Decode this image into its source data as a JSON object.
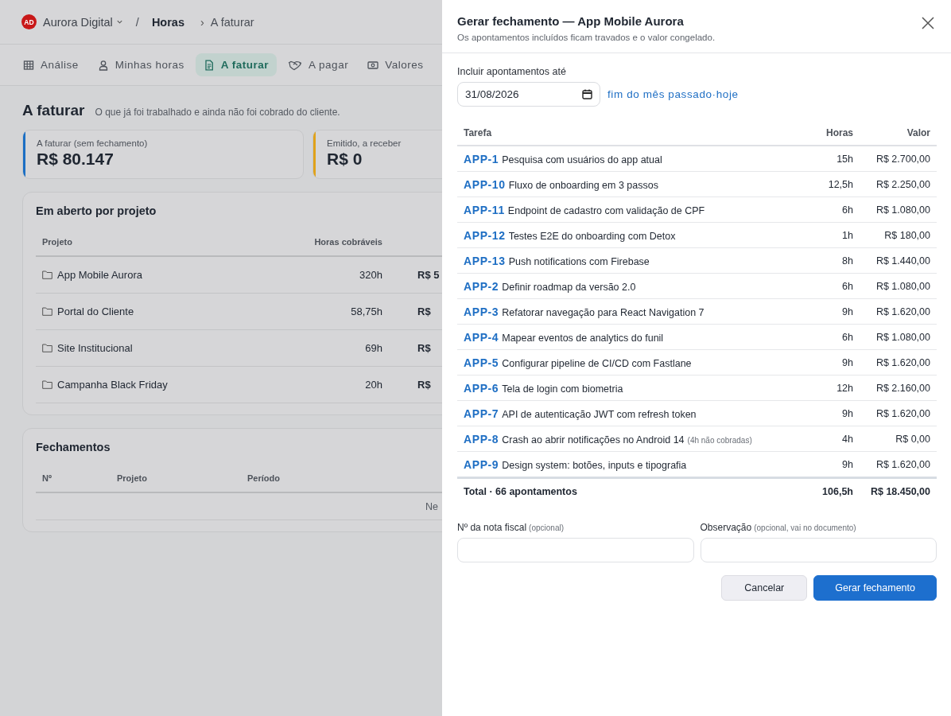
{
  "breadcrumb": {
    "org_initials": "AD",
    "org_name": "Aurora Digital",
    "separator": "/",
    "section": "Horas",
    "arrow": "›",
    "page": "A faturar"
  },
  "tabs": [
    {
      "label": "Análise",
      "kind": "grid",
      "selected": false
    },
    {
      "label": "Minhas horas",
      "kind": "person",
      "selected": false
    },
    {
      "label": "A faturar",
      "kind": "document",
      "selected": true
    },
    {
      "label": "A pagar",
      "kind": "handshake",
      "selected": false
    },
    {
      "label": "Valores",
      "kind": "banknote",
      "selected": false
    }
  ],
  "page": {
    "title": "A faturar",
    "subtitle": "O que já foi trabalhado e ainda não foi cobrado do cliente."
  },
  "metrics": [
    {
      "label": "A faturar (sem fechamento)",
      "value": "R$ 80.147",
      "color": "#1b6fc4"
    },
    {
      "label": "Emitido, a receber",
      "value": "R$ 0",
      "color": "#e0a21a"
    }
  ],
  "open_projects": {
    "title": "Em aberto por projeto",
    "columns": [
      "Projeto",
      "Horas cobráveis"
    ],
    "rows": [
      {
        "name": "App Mobile Aurora",
        "hours": "320h",
        "value": "R$ 5"
      },
      {
        "name": "Portal do Cliente",
        "hours": "58,75h",
        "value": "R$"
      },
      {
        "name": "Site Institucional",
        "hours": "69h",
        "value": "R$"
      },
      {
        "name": "Campanha Black Friday",
        "hours": "20h",
        "value": "R$"
      }
    ]
  },
  "closings": {
    "title": "Fechamentos",
    "columns": [
      "Nº",
      "Projeto",
      "Período"
    ],
    "empty_text": "Ne"
  },
  "drawer": {
    "title": "Gerar fechamento — App Mobile Aurora",
    "subtitle": "Os apontamentos incluídos ficam travados e o valor congelado.",
    "date_label": "Incluir apontamentos até",
    "date_value": "31/08/2026",
    "quick_links": [
      "fim do mês passado",
      "hoje"
    ],
    "link_separator": "·",
    "columns": [
      "Tarefa",
      "Horas",
      "Valor"
    ],
    "rows": [
      {
        "key": "APP-1",
        "title": "Pesquisa com usuários do app atual",
        "hours": "15h",
        "value": "R$ 2.700,00"
      },
      {
        "key": "APP-10",
        "title": "Fluxo de onboarding em 3 passos",
        "hours": "12,5h",
        "value": "R$ 2.250,00"
      },
      {
        "key": "APP-11",
        "title": "Endpoint de cadastro com validação de CPF",
        "hours": "6h",
        "value": "R$ 1.080,00"
      },
      {
        "key": "APP-12",
        "title": "Testes E2E do onboarding com Detox",
        "hours": "1h",
        "value": "R$ 180,00"
      },
      {
        "key": "APP-13",
        "title": "Push notifications com Firebase",
        "hours": "8h",
        "value": "R$ 1.440,00"
      },
      {
        "key": "APP-2",
        "title": "Definir roadmap da versão 2.0",
        "hours": "6h",
        "value": "R$ 1.080,00"
      },
      {
        "key": "APP-3",
        "title": "Refatorar navegação para React Navigation 7",
        "hours": "9h",
        "value": "R$ 1.620,00"
      },
      {
        "key": "APP-4",
        "title": "Mapear eventos de analytics do funil",
        "hours": "6h",
        "value": "R$ 1.080,00"
      },
      {
        "key": "APP-5",
        "title": "Configurar pipeline de CI/CD com Fastlane",
        "hours": "9h",
        "value": "R$ 1.620,00"
      },
      {
        "key": "APP-6",
        "title": "Tela de login com biometria",
        "hours": "12h",
        "value": "R$ 2.160,00"
      },
      {
        "key": "APP-7",
        "title": "API de autenticação JWT com refresh token",
        "hours": "9h",
        "value": "R$ 1.620,00"
      },
      {
        "key": "APP-8",
        "title": "Crash ao abrir notificações no Android 14",
        "note": "(4h não cobradas)",
        "hours": "4h",
        "value": "R$ 0,00"
      },
      {
        "key": "APP-9",
        "title": "Design system: botões, inputs e tipografia",
        "hours": "9h",
        "value": "R$ 1.620,00"
      }
    ],
    "total": {
      "label": "Total · 66 apontamentos",
      "hours": "106,5h",
      "value": "R$ 18.450,00"
    },
    "fields": [
      {
        "label": "Nº da nota fiscal",
        "hint": "(opcional)"
      },
      {
        "label": "Observação",
        "hint": "(opcional, vai no documento)"
      }
    ],
    "buttons": [
      {
        "label": "Cancelar",
        "kind": "secondary"
      },
      {
        "label": "Gerar fechamento",
        "kind": "primary"
      }
    ]
  }
}
